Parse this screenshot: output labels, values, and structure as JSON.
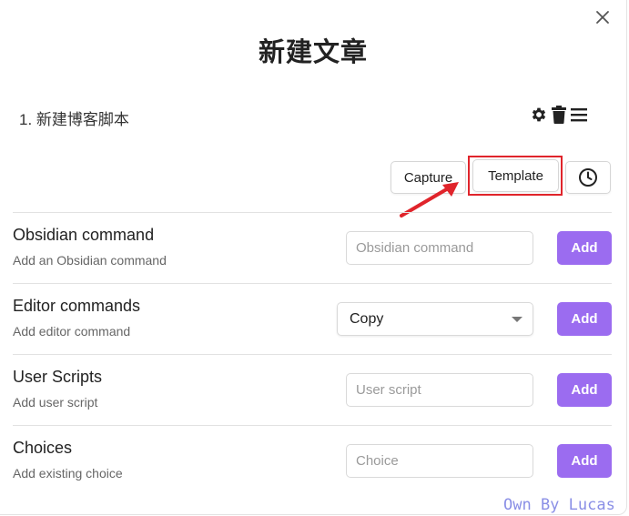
{
  "modal": {
    "title": "新建文章",
    "macro_name": "1. 新建博客脚本"
  },
  "add_choice": {
    "capture_label": "Capture",
    "template_label": "Template"
  },
  "settings": {
    "obsidian": {
      "name": "Obsidian command",
      "desc": "Add an Obsidian command",
      "placeholder": "Obsidian command",
      "add_label": "Add"
    },
    "editor": {
      "name": "Editor commands",
      "desc": "Add editor command",
      "selected": "Copy",
      "add_label": "Add"
    },
    "scripts": {
      "name": "User Scripts",
      "desc": "Add user script",
      "placeholder": "User script",
      "add_label": "Add"
    },
    "choices": {
      "name": "Choices",
      "desc": "Add existing choice",
      "placeholder": "Choice",
      "add_label": "Add"
    }
  },
  "watermark": "Own By Lucas",
  "colors": {
    "accent": "#9b6cf0",
    "highlight_box": "#e0242b",
    "watermark": "#8a8fe6"
  },
  "icons": [
    "close-icon",
    "gear-icon",
    "trash-icon",
    "menu-icon",
    "clock-icon",
    "arrow-annotation"
  ]
}
